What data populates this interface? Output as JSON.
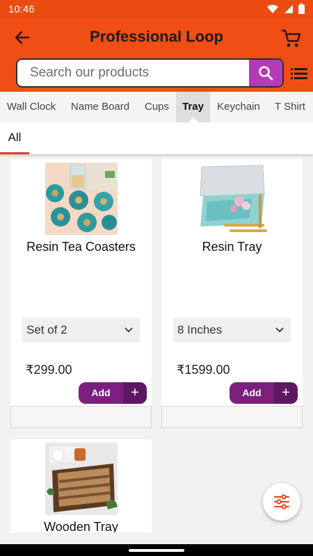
{
  "status": {
    "time": "10:46"
  },
  "header": {
    "title": "Professional Loop"
  },
  "search": {
    "placeholder": "Search our products"
  },
  "categories": [
    "Wall Clock",
    "Name Board",
    "Cups",
    "Tray",
    "Keychain",
    "T Shirt"
  ],
  "active_category": "Tray",
  "subtabs": [
    "All"
  ],
  "products": [
    {
      "name": "Resin Tea Coasters",
      "variant": "Set of 2",
      "price": "₹299.00",
      "add_label": "Add",
      "plus": "+"
    },
    {
      "name": "Resin Tray",
      "variant": "8 Inches",
      "price": "₹1599.00",
      "add_label": "Add",
      "plus": "+"
    },
    {
      "name": "Wooden Tray"
    }
  ],
  "colors": {
    "brand": "#f04e14",
    "accent_purple": "#7a1f7d",
    "search_button": "#b53ab8",
    "active_tab_underline": "#e2401b"
  },
  "icons": {
    "back": "arrow-left-icon",
    "cart": "shopping-cart-icon",
    "search": "search-icon",
    "list": "list-icon",
    "filter": "filter-sliders-icon"
  }
}
